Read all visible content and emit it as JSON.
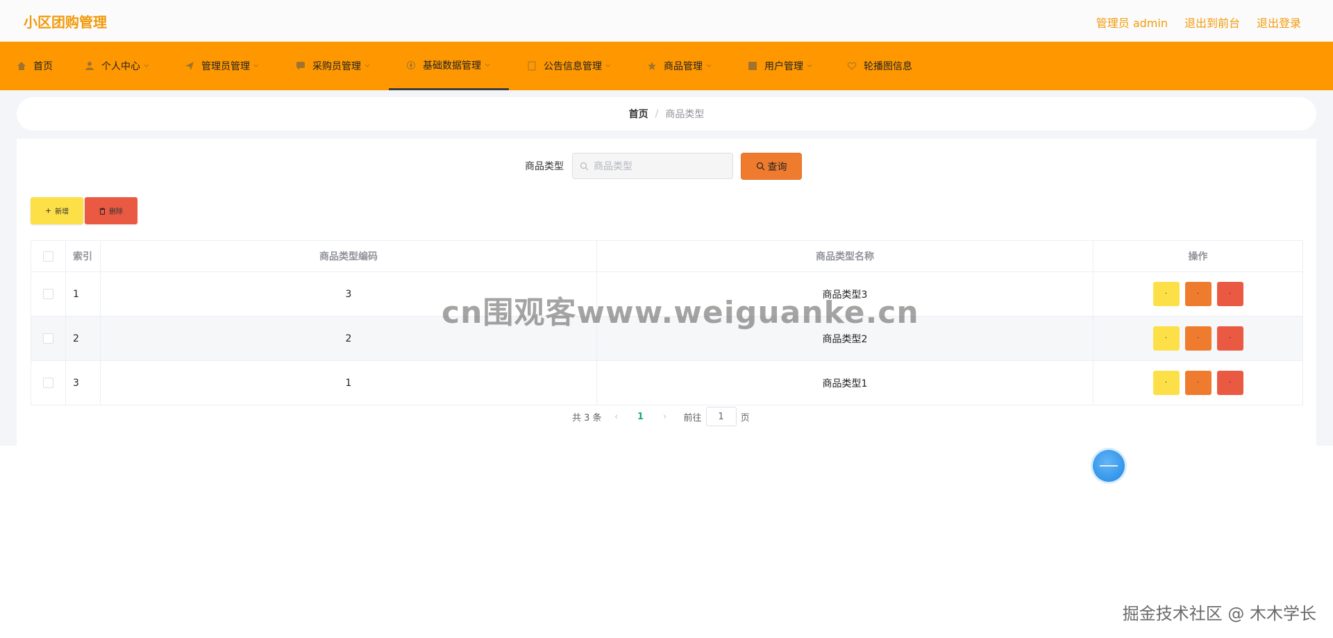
{
  "app": {
    "title": "小区团购管理"
  },
  "top_links": {
    "admin": "管理员 admin",
    "frontend": "退出到前台",
    "logout": "退出登录"
  },
  "nav": [
    {
      "label": "首页",
      "icon": "home-icon"
    },
    {
      "label": "个人中心",
      "icon": "user-icon"
    },
    {
      "label": "管理员管理",
      "icon": "send-icon"
    },
    {
      "label": "采购员管理",
      "icon": "chat-icon"
    },
    {
      "label": "基础数据管理",
      "icon": "compass-icon",
      "active": true
    },
    {
      "label": "公告信息管理",
      "icon": "document-icon"
    },
    {
      "label": "商品管理",
      "icon": "star-icon"
    },
    {
      "label": "用户管理",
      "icon": "grid-icon"
    },
    {
      "label": "轮播图信息",
      "icon": "heart-icon"
    }
  ],
  "breadcrumb": {
    "home": "首页",
    "separator": "/",
    "current": "商品类型"
  },
  "search": {
    "label": "商品类型",
    "placeholder": "商品类型",
    "button": "查询"
  },
  "actions": {
    "add": "新增",
    "delete": "删除"
  },
  "table": {
    "columns": {
      "index": "索引",
      "code": "商品类型编码",
      "name": "商品类型名称",
      "ops": "操作"
    },
    "rows": [
      {
        "index": "1",
        "code": "3",
        "name": "商品类型3"
      },
      {
        "index": "2",
        "code": "2",
        "name": "商品类型2"
      },
      {
        "index": "3",
        "code": "1",
        "name": "商品类型1"
      }
    ],
    "op_labels": {
      "view": "·",
      "edit": "·",
      "remove": "·"
    }
  },
  "pagination": {
    "total": "共 3 条",
    "current_page": "1",
    "goto_label": "前往",
    "goto_value": "1",
    "page_suffix": "页"
  },
  "overlays": {
    "watermark": "cn围观客www.weiguanke.cn",
    "credit": "掘金技术社区 @ 木木学长"
  },
  "colors": {
    "nav_bg": "#ff9800",
    "accent_text": "#f29a0b",
    "add": "#fde047",
    "edit": "#ef7b2f",
    "delete": "#ea5a43"
  }
}
